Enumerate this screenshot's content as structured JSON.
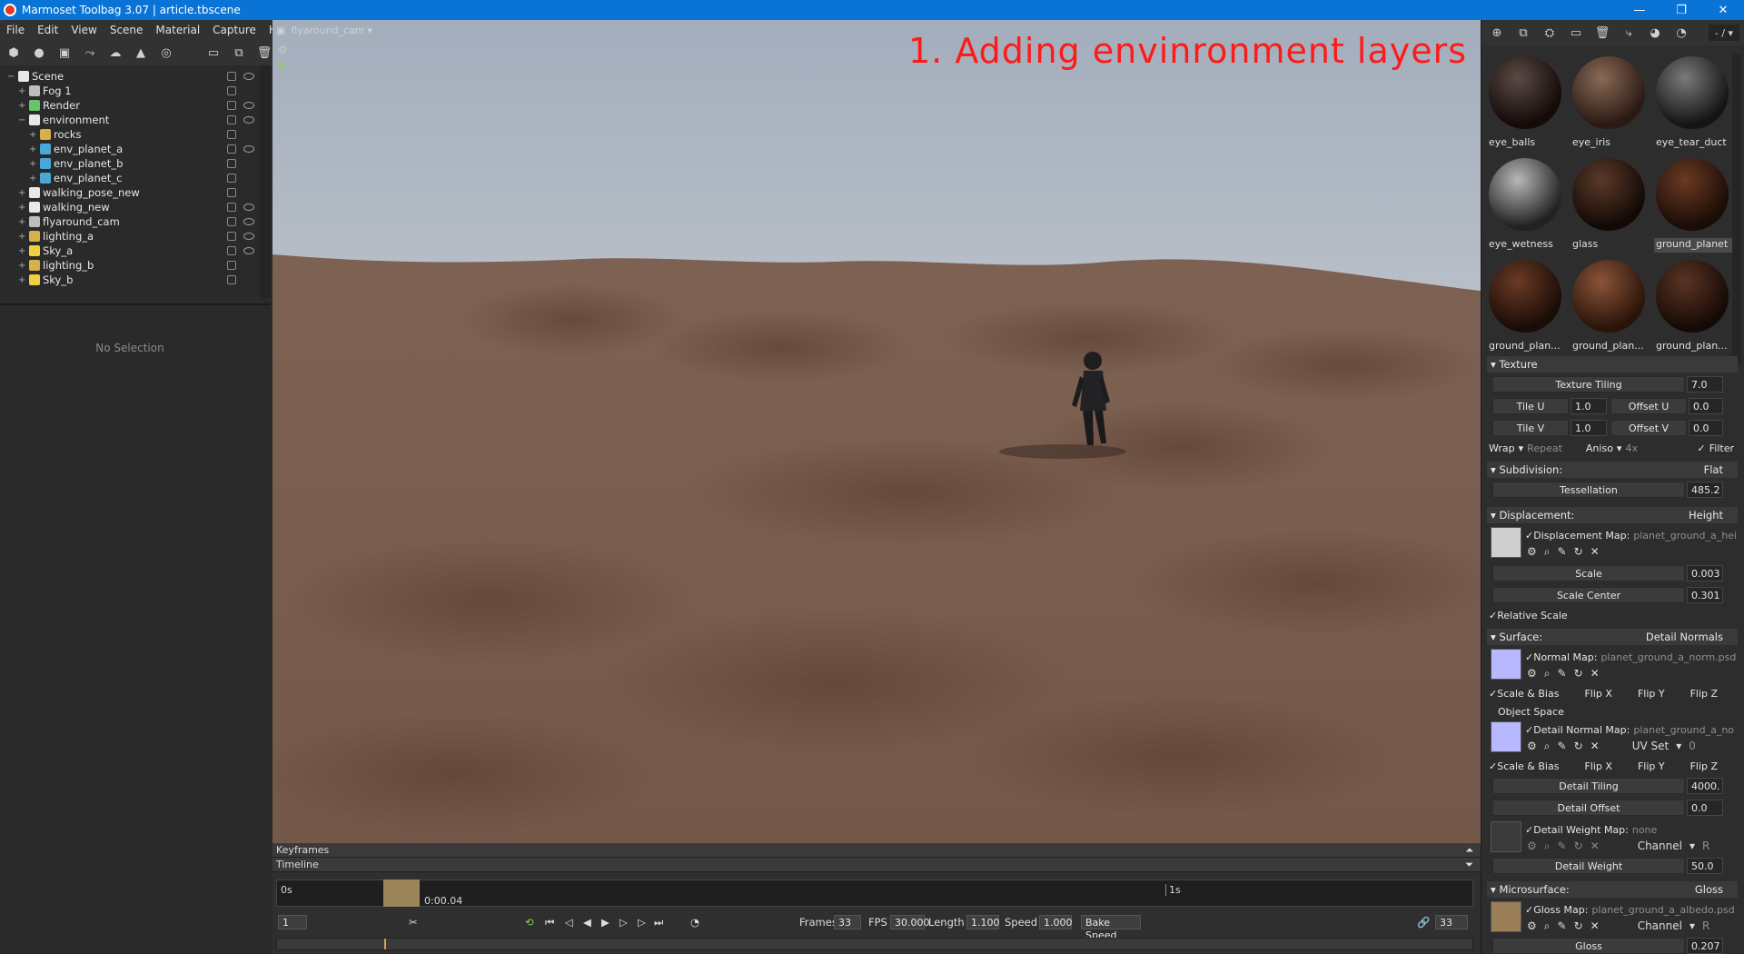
{
  "window": {
    "title": "Marmoset Toolbag 3.07  |  article.tbscene",
    "min": "—",
    "restore": "❐",
    "close": "✕"
  },
  "menu": [
    "File",
    "Edit",
    "View",
    "Scene",
    "Material",
    "Capture",
    "Help"
  ],
  "scene_tree": [
    {
      "label": "Scene",
      "indent": 0,
      "color": "#e8e8e8"
    },
    {
      "label": "Fog 1",
      "indent": 1,
      "color": "#bdbdbd"
    },
    {
      "label": "Render",
      "indent": 1,
      "color": "#6cc36c"
    },
    {
      "label": "environment",
      "indent": 1,
      "color": "#e8e8e8"
    },
    {
      "label": "rocks",
      "indent": 2,
      "color": "#d8b04a"
    },
    {
      "label": "env_planet_a",
      "indent": 2,
      "color": "#4aa8d8"
    },
    {
      "label": "env_planet_b",
      "indent": 2,
      "color": "#4aa8d8"
    },
    {
      "label": "env_planet_c",
      "indent": 2,
      "color": "#4aa8d8"
    },
    {
      "label": "walking_pose_new",
      "indent": 1,
      "color": "#e8e8e8"
    },
    {
      "label": "walking_new",
      "indent": 1,
      "color": "#e8e8e8"
    },
    {
      "label": "flyaround_cam",
      "indent": 1,
      "color": "#bdbdbd"
    },
    {
      "label": "lighting_a",
      "indent": 1,
      "color": "#d8b04a"
    },
    {
      "label": "Sky_a",
      "indent": 1,
      "color": "#f0d040"
    },
    {
      "label": "lighting_b",
      "indent": 1,
      "color": "#d8b04a"
    },
    {
      "label": "Sky_b",
      "indent": 1,
      "color": "#f0d040"
    }
  ],
  "props": {
    "no_selection": "No Selection"
  },
  "viewport": {
    "camera": "flyaround_cam",
    "overlay_title": "1. Adding envinronment layers"
  },
  "timeline": {
    "keyframes_label": "Keyframes",
    "timeline_label": "Timeline",
    "start": "0s",
    "current": "0:00.04",
    "end": "1s",
    "frame_field": "1",
    "frames_label": "Frames",
    "frames": "33",
    "fps_label": "FPS",
    "fps": "30.000",
    "length_label": "Length",
    "length": "1.100",
    "speed_label": "Speed",
    "speed": "1.000",
    "bake_speed": "Bake Speed",
    "end_frame": "33"
  },
  "materials": [
    {
      "name": "eye_balls",
      "c1": "#5a4a44",
      "c2": "#140a08"
    },
    {
      "name": "eye_iris",
      "c1": "#8a6a55",
      "c2": "#2a1a14"
    },
    {
      "name": "eye_tear_duct",
      "c1": "#7a7a7a",
      "c2": "#141414"
    },
    {
      "name": "eye_wetness",
      "c1": "#b8b8b8",
      "c2": "#222222"
    },
    {
      "name": "glass",
      "c1": "#5a3a28",
      "c2": "#120906"
    },
    {
      "name": "ground_planet",
      "c1": "#6a3a24",
      "c2": "#1a0c06"
    },
    {
      "name": "ground_plan...",
      "c1": "#6a3a24",
      "c2": "#1a0c06"
    },
    {
      "name": "ground_plan...",
      "c1": "#8a5438",
      "c2": "#2a140a"
    },
    {
      "name": "ground_plan...",
      "c1": "#5a3424",
      "c2": "#150a06"
    }
  ],
  "texture": {
    "section": "Texture",
    "tiling_label": "Texture Tiling",
    "tiling": "7.0",
    "tile_u_label": "Tile U",
    "tile_u": "1.0",
    "offset_u_label": "Offset U",
    "offset_u": "0.0",
    "tile_v_label": "Tile V",
    "tile_v": "1.0",
    "offset_v_label": "Offset V",
    "offset_v": "0.0",
    "wrap_label": "Wrap",
    "wrap": "Repeat",
    "aniso_label": "Aniso",
    "aniso": "4x",
    "filter": "Filter"
  },
  "subdivision": {
    "section": "Subdivision:",
    "mode": "Flat",
    "tess_label": "Tessellation",
    "tess": "485.2"
  },
  "displacement": {
    "section": "Displacement:",
    "mode": "Height",
    "map_label": "Displacement Map:",
    "map": "planet_ground_a_hei",
    "scale_label": "Scale",
    "scale": "0.003",
    "center_label": "Scale Center",
    "center": "0.301",
    "relative": "Relative Scale"
  },
  "surface": {
    "section": "Surface:",
    "mode": "Detail Normals",
    "normal_label": "Normal Map:",
    "normal_map": "planet_ground_a_norm.psd",
    "scale_bias": "Scale & Bias",
    "flip_x": "Flip X",
    "flip_y": "Flip Y",
    "flip_z": "Flip Z",
    "object_space": "Object Space",
    "detail_label": "Detail Normal Map:",
    "detail_map": "planet_ground_a_no",
    "uv_set_label": "UV Set",
    "uv_set": "0",
    "detail_tiling_label": "Detail Tiling",
    "detail_tiling": "4000.",
    "detail_offset_label": "Detail Offset",
    "detail_offset": "0.0",
    "weight_map_label": "Detail Weight Map:",
    "weight_map": "none",
    "channel_label": "Channel",
    "channel": "R",
    "detail_weight_label": "Detail Weight",
    "detail_weight": "50.0"
  },
  "microsurface": {
    "section": "Microsurface:",
    "mode": "Gloss",
    "gloss_map_label": "Gloss Map:",
    "gloss_map": "planet_ground_a_albedo.psd",
    "channel_label": "Channel",
    "channel": "R",
    "gloss_label": "Gloss",
    "gloss": "0.207"
  },
  "colors": {
    "title_bg": "#0a74d6",
    "overlay_red": "#ff1a1a",
    "ground": "#7a5e4e"
  }
}
